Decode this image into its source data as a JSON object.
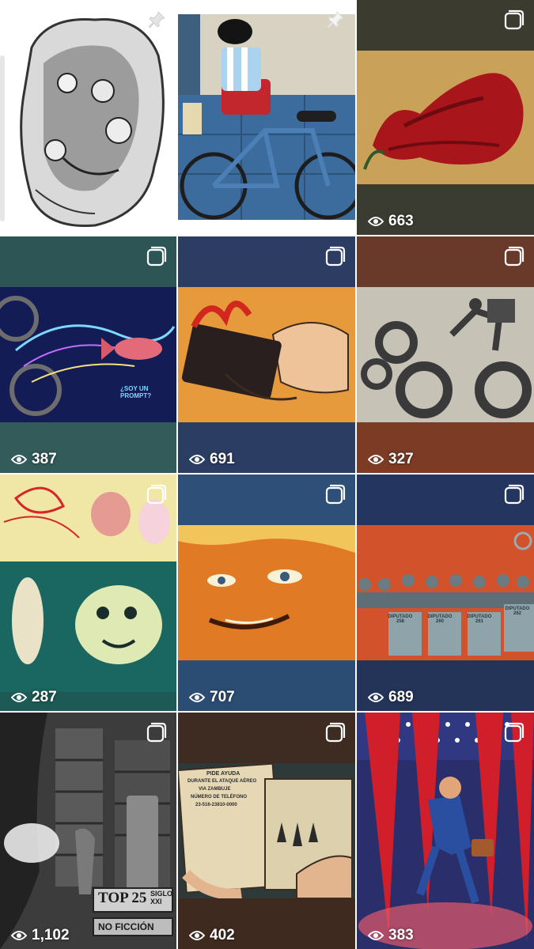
{
  "posts": [
    {
      "id": "p1",
      "kind": "pinned",
      "views": ""
    },
    {
      "id": "p2",
      "kind": "pinned",
      "views": ""
    },
    {
      "id": "p3",
      "kind": "reel",
      "views": "663"
    },
    {
      "id": "p4",
      "kind": "reel",
      "views": "387",
      "caption": "¿SOY UN PROMPT?"
    },
    {
      "id": "p5",
      "kind": "reel",
      "views": "691"
    },
    {
      "id": "p6",
      "kind": "reel",
      "views": "327"
    },
    {
      "id": "p7",
      "kind": "reel",
      "views": "287"
    },
    {
      "id": "p8",
      "kind": "reel",
      "views": "707"
    },
    {
      "id": "p9",
      "kind": "reel",
      "views": "689",
      "labels": [
        "DIPUTADO 258",
        "DIPUTADO 260",
        "DIPUTADO 261",
        "DIPUTADO 262"
      ]
    },
    {
      "id": "p10",
      "kind": "reel",
      "views": "1,102",
      "labels": [
        "TOP 25",
        "SIGLO XXI",
        "NO FICCIÓN"
      ]
    },
    {
      "id": "p11",
      "kind": "reel",
      "views": "402",
      "labels": [
        "PIDE AYUDA",
        "DURANTE EL ATAQUE AÉREO",
        "VIA ZAMBUJE",
        "NÚMERO DE TELÉFONO",
        "23-516-23810-0000"
      ]
    },
    {
      "id": "p12",
      "kind": "reel",
      "views": "383"
    }
  ],
  "icons": {
    "pinned": "pin-icon",
    "reel": "reel-icon",
    "views": "eye-icon"
  },
  "colors": {
    "overlay_text": "#ffffff",
    "grid_gap": "#ffffff"
  }
}
